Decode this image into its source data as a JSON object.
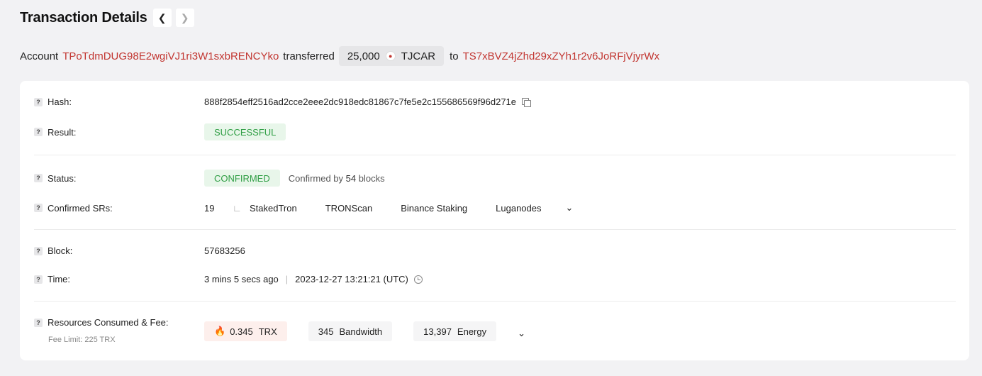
{
  "header": {
    "title": "Transaction Details",
    "prev_icon": "chevron-left-icon",
    "next_icon": "chevron-right-icon"
  },
  "summary": {
    "account_label": "Account",
    "from_address": "TPoTdmDUG98E2wgiVJ1ri3W1sxbRENCYko",
    "action": "transferred",
    "amount": "25,000",
    "token": "TJCAR",
    "to_label": "to",
    "to_address": "TS7xBVZ4jZhd29xZYh1r2v6JoRFjVjyrWx"
  },
  "details": {
    "hash": {
      "label": "Hash:",
      "value": "888f2854eff2516ad2cce2eee2dc918edc81867c7fe5e2c155686569f96d271e"
    },
    "result": {
      "label": "Result:",
      "value": "SUCCESSFUL"
    },
    "status": {
      "label": "Status:",
      "value": "CONFIRMED",
      "confirmed_prefix": "Confirmed by",
      "blocks_count": "54",
      "blocks_suffix": "blocks"
    },
    "confirmed_srs": {
      "label": "Confirmed SRs:",
      "count": "19",
      "items": [
        "StakedTron",
        "TRONScan",
        "Binance Staking",
        "Luganodes"
      ]
    },
    "block": {
      "label": "Block:",
      "value": "57683256"
    },
    "time": {
      "label": "Time:",
      "relative": "3 mins 5 secs ago",
      "separator": "|",
      "absolute": "2023-12-27 13:21:21 (UTC)"
    },
    "resources": {
      "label": "Resources Consumed & Fee:",
      "fee_limit": "Fee Limit: 225 TRX",
      "trx_value": "0.345",
      "trx_unit": "TRX",
      "bandwidth_value": "345",
      "bandwidth_unit": "Bandwidth",
      "energy_value": "13,397",
      "energy_unit": "Energy"
    }
  },
  "colors": {
    "address": "#c23631",
    "success_bg": "#e8f6ea",
    "success_text": "#2f9e44"
  }
}
